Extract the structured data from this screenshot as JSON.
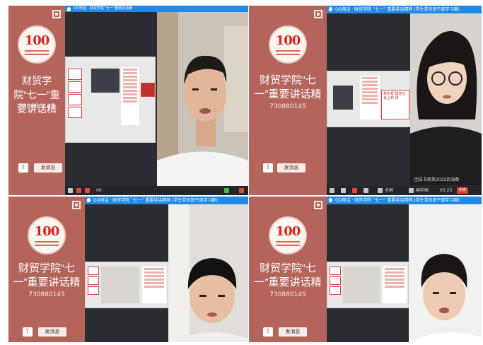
{
  "group": {
    "name": "财贸学院“七一”重要讲话精",
    "id": "730880145",
    "send_label": "发消息",
    "logo_number": "100",
    "qr_icon": "qr-code-icon",
    "share_icon": "share-icon"
  },
  "meeting": {
    "title_tl": "QQ电话 - 财贸学院“七一”重要讲话精",
    "title_tr": "QQ电话 · 财贸学院 “七一” 重要讲话精神 (学生党员团干部学习群)",
    "title_bl": "QQ电话 · 财贸学院 “七一” 重要讲话精神 (学生党员团干部学习群)",
    "title_br": "QQ电话 · 财贸学院 “七一” 重要讲话精神 (学生党员团干部学习群)"
  },
  "controls": {
    "tl_left": "00:",
    "tr_fullscreen": "全屏",
    "tr_pip": "画中画",
    "tr_time": "05:23",
    "tr_end": "结束",
    "watermark": "团支书商英2022百海燕"
  },
  "slide_text": {
    "tr": "我庆祝 建党大会上的 讲"
  },
  "colors": {
    "sidebar": "#b4645a",
    "titlebar": "#1f8ae8",
    "end_button": "#e53d30"
  }
}
